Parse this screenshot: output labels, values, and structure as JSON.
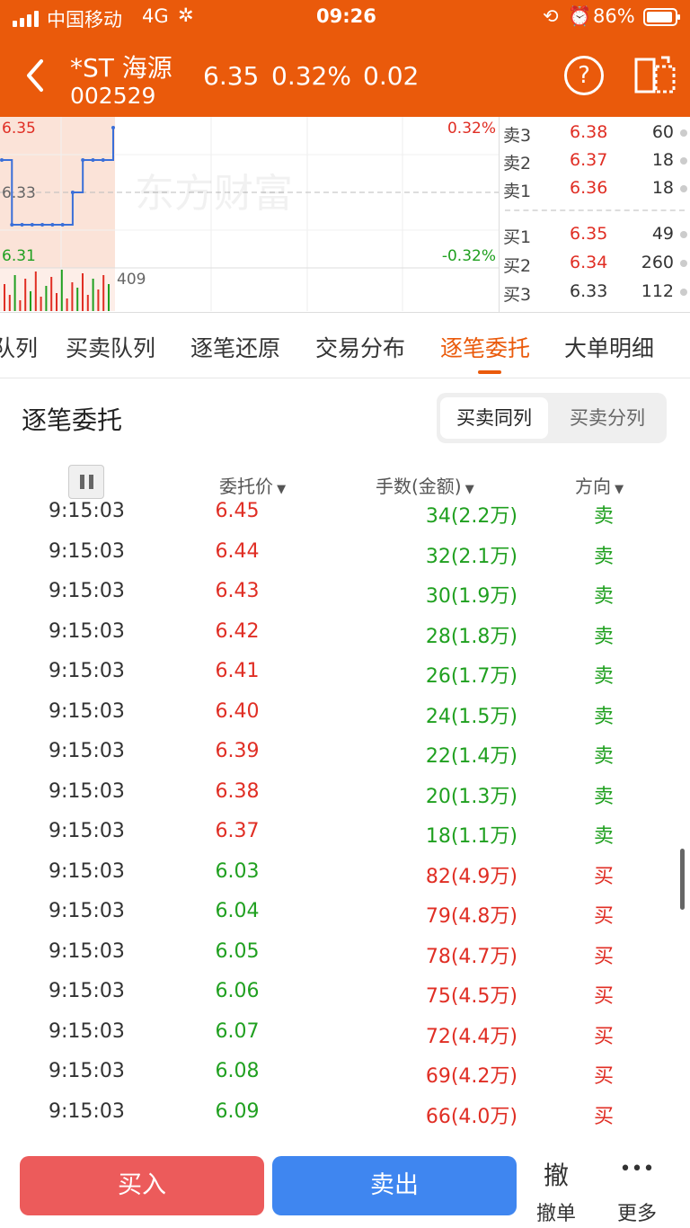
{
  "status_bar": {
    "carrier": "中国移动",
    "network": "4G",
    "time": "09:26",
    "battery": "86%"
  },
  "header": {
    "stock_name": "*ST 海源",
    "stock_code": "002529",
    "price": "6.35",
    "change_pct": "0.32%",
    "change": "0.02",
    "help_icon": "question-circle-icon",
    "switch_icon": "layout-switch-icon"
  },
  "mini_chart": {
    "high": "6.35",
    "mid": "6.33",
    "low": "6.31",
    "up_pct": "0.32%",
    "down_pct": "-0.32%",
    "volume_label": "409",
    "watermark": "东方财富",
    "price_points": [
      6.34,
      6.32,
      6.32,
      6.32,
      6.32,
      6.32,
      6.32,
      6.33,
      6.34,
      6.34,
      6.34,
      6.35
    ]
  },
  "order_book": {
    "asks": [
      {
        "label": "卖3",
        "price": "6.38",
        "vol": "60"
      },
      {
        "label": "卖2",
        "price": "6.37",
        "vol": "18"
      },
      {
        "label": "卖1",
        "price": "6.36",
        "vol": "18"
      }
    ],
    "bids": [
      {
        "label": "买1",
        "price": "6.35",
        "vol": "49"
      },
      {
        "label": "买2",
        "price": "6.34",
        "vol": "260"
      },
      {
        "label": "买3",
        "price": "6.33",
        "vol": "112"
      }
    ]
  },
  "tabs": [
    "队列",
    "买卖队列",
    "逐笔还原",
    "交易分布",
    "逐笔委托",
    "大单明细"
  ],
  "active_tab": 4,
  "section": {
    "title": "逐笔委托",
    "seg_same": "买卖同列",
    "seg_split": "买卖分列"
  },
  "columns": {
    "price": "委托价",
    "qty": "手数(金额)",
    "dir": "方向"
  },
  "rows": [
    {
      "time": "9:15:03",
      "price": "6.45",
      "qty": "34(2.2万)",
      "dir": "卖"
    },
    {
      "time": "9:15:03",
      "price": "6.44",
      "qty": "32(2.1万)",
      "dir": "卖"
    },
    {
      "time": "9:15:03",
      "price": "6.43",
      "qty": "30(1.9万)",
      "dir": "卖"
    },
    {
      "time": "9:15:03",
      "price": "6.42",
      "qty": "28(1.8万)",
      "dir": "卖"
    },
    {
      "time": "9:15:03",
      "price": "6.41",
      "qty": "26(1.7万)",
      "dir": "卖"
    },
    {
      "time": "9:15:03",
      "price": "6.40",
      "qty": "24(1.5万)",
      "dir": "卖"
    },
    {
      "time": "9:15:03",
      "price": "6.39",
      "qty": "22(1.4万)",
      "dir": "卖"
    },
    {
      "time": "9:15:03",
      "price": "6.38",
      "qty": "20(1.3万)",
      "dir": "卖"
    },
    {
      "time": "9:15:03",
      "price": "6.37",
      "qty": "18(1.1万)",
      "dir": "卖"
    },
    {
      "time": "9:15:03",
      "price": "6.03",
      "qty": "82(4.9万)",
      "dir": "买"
    },
    {
      "time": "9:15:03",
      "price": "6.04",
      "qty": "79(4.8万)",
      "dir": "买"
    },
    {
      "time": "9:15:03",
      "price": "6.05",
      "qty": "78(4.7万)",
      "dir": "买"
    },
    {
      "time": "9:15:03",
      "price": "6.06",
      "qty": "75(4.5万)",
      "dir": "买"
    },
    {
      "time": "9:15:03",
      "price": "6.07",
      "qty": "72(4.4万)",
      "dir": "买"
    },
    {
      "time": "9:15:03",
      "price": "6.08",
      "qty": "69(4.2万)",
      "dir": "买"
    },
    {
      "time": "9:15:03",
      "price": "6.09",
      "qty": "66(4.0万)",
      "dir": "买"
    }
  ],
  "bottom": {
    "buy": "买入",
    "sell": "卖出",
    "cancel_glyph": "撤",
    "cancel_label": "撤单",
    "more_glyph": "•••",
    "more_label": "更多"
  },
  "colors": {
    "brand": "#ea5a0b",
    "up": "#e02e24",
    "down": "#20a020",
    "buy_btn": "#ec5b5b",
    "sell_btn": "#3f86f0"
  }
}
